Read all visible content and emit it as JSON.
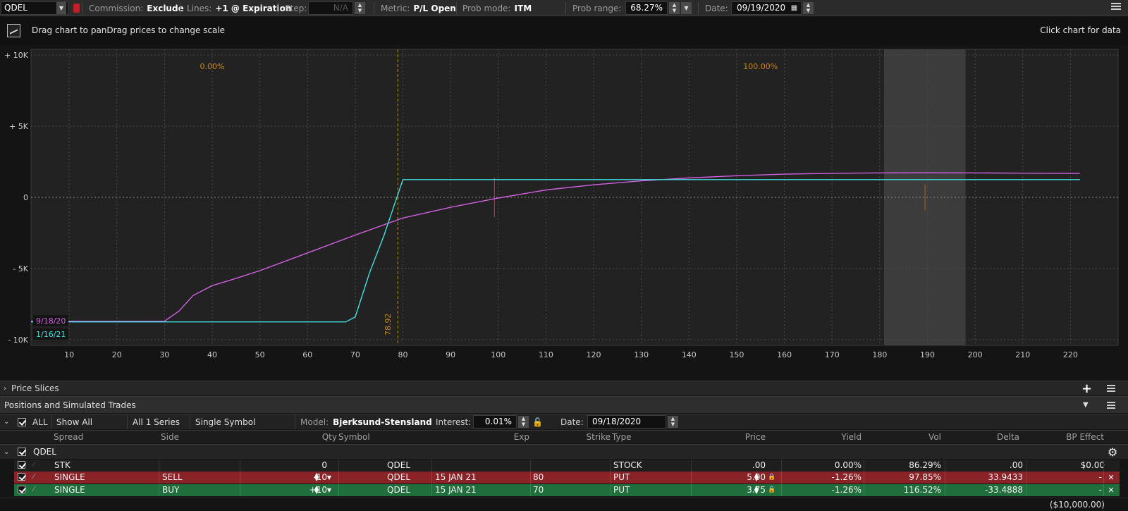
{
  "toolbar": {
    "symbol": "QDEL",
    "commission_label": "Commission:",
    "commission_value": "Exclude",
    "lines_label": "Lines:",
    "lines_value": "+1 @ Expiration",
    "step_label": "Step:",
    "step_value": "N/A",
    "metric_label": "Metric:",
    "metric_value": "P/L Open",
    "probmode_label": "Prob mode:",
    "probmode_value": "ITM",
    "probrange_label": "Prob range:",
    "probrange_value": "68.27%",
    "date_label": "Date:",
    "date_value": "09/19/2020"
  },
  "info": {
    "hint": "Drag chart to panDrag prices to change scale",
    "click_hint": "Click chart for data"
  },
  "chart_data": {
    "type": "line",
    "xlim": [
      2,
      230
    ],
    "ylim": [
      -10400,
      10400
    ],
    "xticks": [
      10,
      20,
      30,
      40,
      50,
      60,
      70,
      80,
      90,
      100,
      110,
      120,
      130,
      140,
      150,
      160,
      170,
      180,
      190,
      200,
      210,
      220
    ],
    "yticks": [
      {
        "value": 10000,
        "label": "+ 10K"
      },
      {
        "value": 5000,
        "label": "+ 5K"
      },
      {
        "value": 0,
        "label": "0"
      },
      {
        "value": -5000,
        "label": "- 5K"
      },
      {
        "value": -10000,
        "label": "- 10K"
      }
    ],
    "grid": true,
    "series": [
      {
        "name": "9/18/20",
        "color": "#d060e0",
        "x": [
          2,
          30,
          33,
          36,
          40,
          44,
          50,
          60,
          70,
          80,
          90,
          100,
          110,
          120,
          130,
          140,
          150,
          160,
          170,
          180,
          190,
          200,
          210,
          222
        ],
        "y": [
          -8700,
          -8700,
          -8000,
          -6900,
          -6200,
          -5800,
          -5150,
          -3900,
          -2650,
          -1450,
          -700,
          -50,
          520,
          880,
          1160,
          1360,
          1520,
          1630,
          1690,
          1720,
          1730,
          1720,
          1700,
          1690
        ]
      },
      {
        "name": "1/16/21",
        "color": "#40e0e0",
        "x": [
          2,
          68,
          70,
          73,
          76,
          80,
          222
        ],
        "y": [
          -8750,
          -8750,
          -8400,
          -5300,
          -2700,
          1250,
          1250
        ]
      }
    ],
    "breakeven": {
      "x": 78.92,
      "label": "78.92"
    },
    "prob_labels": [
      {
        "x": 40,
        "text": "0.00%"
      },
      {
        "x": 155,
        "text": "100.00%"
      }
    ],
    "prob_band": [
      180.9,
      198
    ]
  },
  "price_slices": {
    "label": "Price Slices"
  },
  "positions": {
    "title": "Positions and Simulated Trades",
    "filters": {
      "all": "ALL",
      "show": "Show All",
      "series": "All 1 Series",
      "symbol": "Single Symbol",
      "model_label": "Model:",
      "model_value": "Bjerksund-Stensland",
      "interest_label": "Interest:",
      "interest_value": "0.01%",
      "date_label": "Date:",
      "date_value": "09/18/2020"
    },
    "columns": [
      "Spread",
      "Side",
      "Qty",
      "Symbol",
      "Exp",
      "Strike",
      "Type",
      "Price",
      "Yield",
      "Vol",
      "Delta",
      "BP Effect"
    ],
    "group": "QDEL",
    "rows": [
      {
        "spread": "STK",
        "side": "",
        "qty": "0",
        "symbol": "QDEL",
        "exp": "",
        "strike": "",
        "type": "STOCK",
        "price": ".00",
        "yield": "0.00%",
        "vol": "86.29%",
        "delta": ".00",
        "bp": "$0.00",
        "style": "neutral"
      },
      {
        "spread": "SINGLE",
        "side": "SELL",
        "qty": "-10",
        "symbol": "QDEL",
        "exp": "15 JAN 21",
        "strike": "80",
        "type": "PUT",
        "price": "5.00",
        "yield": "-1.26%",
        "vol": "97.85%",
        "delta": "33.9433",
        "bp": "-",
        "style": "sell"
      },
      {
        "spread": "SINGLE",
        "side": "BUY",
        "qty": "+10",
        "symbol": "QDEL",
        "exp": "15 JAN 21",
        "strike": "70",
        "type": "PUT",
        "price": "3.75",
        "yield": "-1.26%",
        "vol": "116.52%",
        "delta": "-33.4888",
        "bp": "-",
        "style": "buy"
      }
    ],
    "total_bp": "($10,000.00)"
  }
}
